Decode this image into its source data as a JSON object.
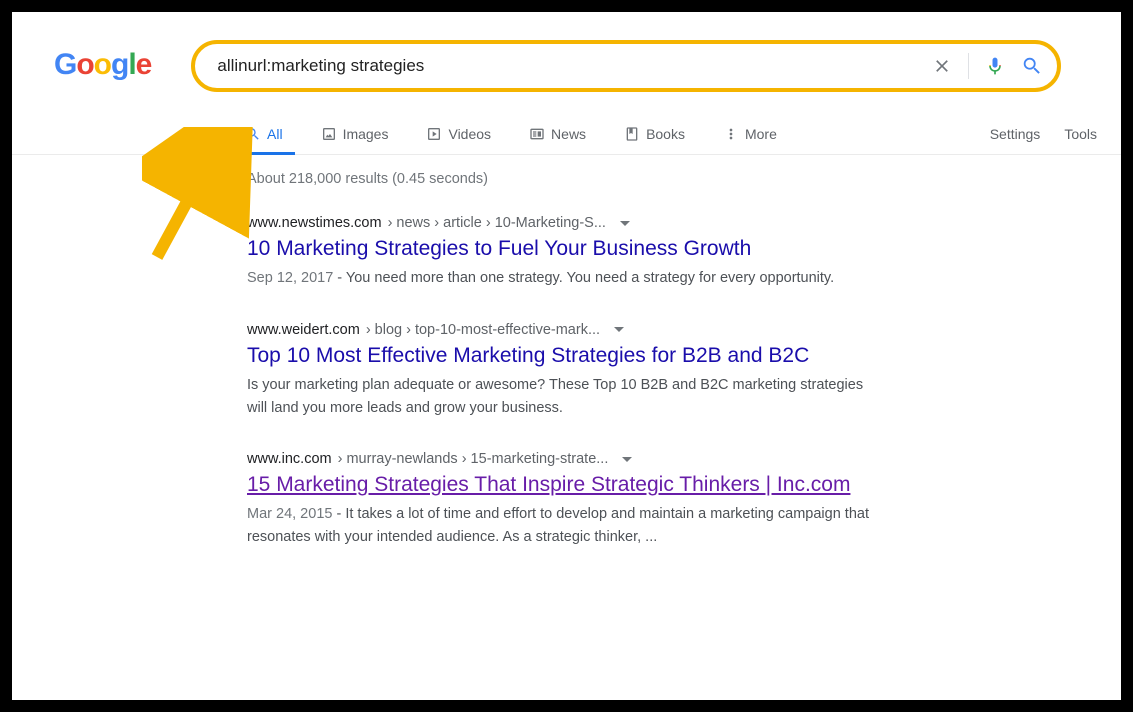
{
  "search": {
    "query": "allinurl:marketing strategies"
  },
  "tabs": {
    "all": "All",
    "images": "Images",
    "videos": "Videos",
    "news": "News",
    "books": "Books",
    "more": "More",
    "settings": "Settings",
    "tools": "Tools"
  },
  "stats": "About 218,000 results (0.45 seconds)",
  "results": [
    {
      "domain": "www.newstimes.com",
      "path": " › news › article › 10-Marketing-S...",
      "title": "10 Marketing Strategies to Fuel Your Business Growth",
      "date": "Sep 12, 2017",
      "snippet": " - You need more than one strategy. You need a strategy for every opportunity."
    },
    {
      "domain": "www.weidert.com",
      "path": " › blog › top-10-most-effective-mark...",
      "title": "Top 10 Most Effective Marketing Strategies for B2B and B2C",
      "date": "",
      "snippet": "Is your marketing plan adequate or awesome? These Top 10 B2B and B2C marketing strategies will land you more leads and grow your business."
    },
    {
      "domain": "www.inc.com",
      "path": " › murray-newlands › 15-marketing-strate...",
      "title": "15 Marketing Strategies That Inspire Strategic Thinkers | Inc.com",
      "date": "Mar 24, 2015",
      "snippet": " - It takes a lot of time and effort to develop and maintain a marketing campaign that resonates with your intended audience. As a strategic thinker, ..."
    }
  ]
}
